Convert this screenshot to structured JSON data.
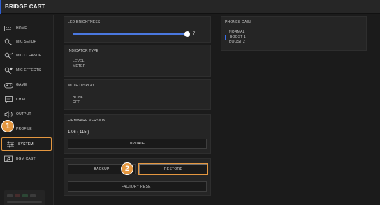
{
  "app": {
    "title": "BRIDGE CAST"
  },
  "colors": {
    "accent": "#2f5fd3",
    "highlight": "#e49740",
    "background": "#1b1b1b",
    "panel": "#252525"
  },
  "sidebar": {
    "items": [
      {
        "label": "HOME",
        "icon": "keyboard-icon"
      },
      {
        "label": "MIC SETUP",
        "icon": "mic-icon"
      },
      {
        "label": "MIC CLEANUP",
        "icon": "mic-cleanup-icon"
      },
      {
        "label": "MIC EFFECTS",
        "icon": "mic-effects-icon"
      },
      {
        "label": "GAME",
        "icon": "gamepad-icon"
      },
      {
        "label": "CHAT",
        "icon": "chat-icon"
      },
      {
        "label": "OUTPUT",
        "icon": "speaker-icon"
      },
      {
        "label": "PROFILE",
        "icon": "profile-icon"
      },
      {
        "label": "SYSTEM",
        "icon": "system-icon",
        "selected": true
      },
      {
        "label": "BGM CAST",
        "icon": "bgm-icon"
      }
    ]
  },
  "callouts": {
    "one": "1",
    "two": "2"
  },
  "led_brightness": {
    "title": "LED BRIGHTNESS",
    "value": "7",
    "level": 7
  },
  "indicator_type": {
    "title": "INDICATOR TYPE",
    "options": [
      "LEVEL",
      "METER"
    ]
  },
  "mute_display": {
    "title": "MUTE DISPLAY",
    "options": [
      "BLINK",
      "OFF"
    ]
  },
  "firmware": {
    "title": "FIRMWARE VERSION",
    "version": "1.06 ( 115 )",
    "update_label": "UPDATE"
  },
  "backup_restore": {
    "backup_label": "BACKUP",
    "restore_label": "RESTORE",
    "factory_reset_label": "FACTORY RESET"
  },
  "phones_gain": {
    "title": "PHONES GAIN",
    "options": [
      "NORMAL",
      "BOOST 1",
      "BOOST 2"
    ]
  }
}
